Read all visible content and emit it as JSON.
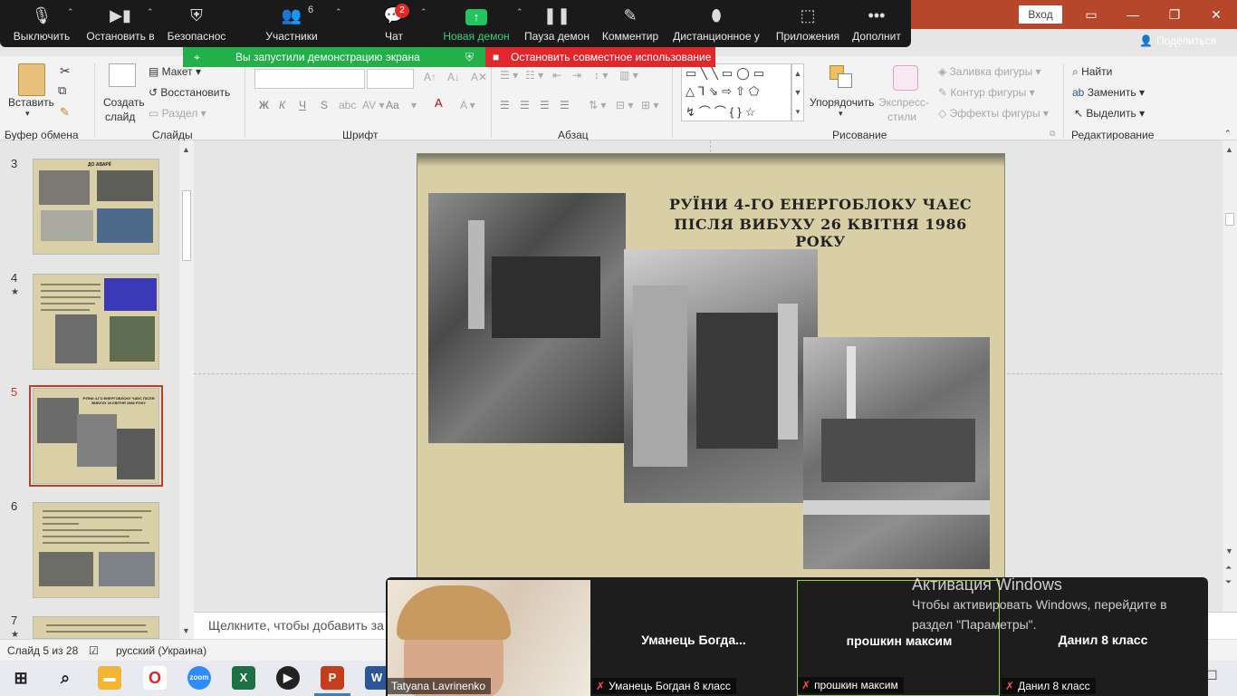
{
  "titlebar": {
    "signin_label": "Вход",
    "share_label": "Поделиться",
    "colors": {
      "accent": "#b7472a"
    }
  },
  "zoom_toolbar": {
    "items": [
      {
        "label": "Выключить",
        "icon": "microphone-icon"
      },
      {
        "label": "Остановить в",
        "icon": "video-camera-icon"
      },
      {
        "label": "Безопаснос",
        "icon": "shield-icon"
      },
      {
        "label": "Участники",
        "icon": "participants-icon",
        "count": "6"
      },
      {
        "label": "Чат",
        "icon": "chat-icon",
        "badge": "2"
      },
      {
        "label": "Новая демон",
        "icon": "share-screen-icon"
      },
      {
        "label": "Пауза демон",
        "icon": "pause-icon"
      },
      {
        "label": "Комментир",
        "icon": "pen-icon"
      },
      {
        "label": "Дистанционное у",
        "icon": "mouse-icon"
      },
      {
        "label": "Приложения",
        "icon": "apps-icon"
      },
      {
        "label": "Дополнит",
        "icon": "more-icon"
      }
    ]
  },
  "share_banner": {
    "sharing_text": "Вы запустили демонстрацию экрана",
    "stop_text": "Остановить совместное использование"
  },
  "ribbon": {
    "clipboard": {
      "paste": "Вставить",
      "group": "Буфер обмена"
    },
    "slides": {
      "new_slide_1": "Создать",
      "new_slide_2": "слайд",
      "layout": "Макет",
      "reset": "Восстановить",
      "section": "Раздел",
      "group": "Слайды"
    },
    "font": {
      "group": "Шрифт",
      "bold": "Ж",
      "italic": "К",
      "underline": "Ч",
      "strike": "S",
      "case": "Aa"
    },
    "paragraph": {
      "group": "Абзац"
    },
    "drawing": {
      "arrange": "Упорядочить",
      "quick_styles_1": "Экспресс-",
      "quick_styles_2": "стили",
      "fill": "Заливка фигуры",
      "outline": "Контур фигуры",
      "effects": "Эффекты фигуры",
      "group": "Рисование"
    },
    "editing": {
      "find": "Найти",
      "replace": "Заменить",
      "select": "Выделить",
      "group": "Редактирование"
    }
  },
  "thumbnails": [
    {
      "number": "3",
      "title": "ДО АВАРІЇ",
      "starred": false
    },
    {
      "number": "4",
      "starred": true
    },
    {
      "number": "5",
      "title": "РУЇНИ 4-ГО ЕНЕРГОБЛОКУ ЧАЕС ПІСЛЯ ВИБУХУ 26 КВІТНЯ 1986 РОКУ",
      "starred": false,
      "selected": true
    },
    {
      "number": "6",
      "starred": false
    },
    {
      "number": "7",
      "starred": true
    }
  ],
  "slide": {
    "title_line1": "РУЇНИ 4-ГО ЕНЕРГОБЛОКУ ЧАЕС",
    "title_line2": "ПІСЛЯ ВИБУХУ 26 КВІТНЯ 1986 РОКУ"
  },
  "notes_placeholder": "Щелкните, чтобы добавить за",
  "status": {
    "slide_counter": "Слайд 5 из 28",
    "language": "русский (Украина)"
  },
  "video_strip": {
    "tiles": [
      {
        "label": "Tatyana Lavrinenko",
        "name": "",
        "muted": false,
        "has_video": true
      },
      {
        "label": "Уманець Богдан 8 класс",
        "name": "Уманець  Богда...",
        "muted": true,
        "has_video": false
      },
      {
        "label": "прошкин максим",
        "name": "прошкин максим",
        "muted": true,
        "has_video": false,
        "active_speaker": true
      },
      {
        "label": "Данил 8 класс",
        "name": "Данил 8 класс",
        "muted": true,
        "has_video": false
      }
    ]
  },
  "activation": {
    "title": "Активация Windows",
    "line1": "Чтобы активировать Windows, перейдите в",
    "line2": "раздел \"Параметры\"."
  },
  "taskbar": {
    "apps": [
      "start-icon",
      "search-icon",
      "file-explorer-icon",
      "opera-icon",
      "zoom-icon",
      "excel-icon",
      "media-player-icon",
      "powerpoint-icon",
      "word-icon"
    ]
  }
}
